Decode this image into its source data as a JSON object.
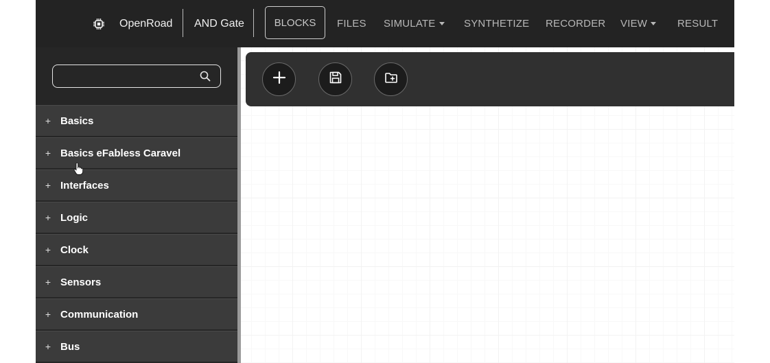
{
  "app": {
    "name": "OpenRoad",
    "project": "AND Gate",
    "logo_icon": "chip-icon"
  },
  "nav": {
    "items": [
      {
        "label": "BLOCKS",
        "active": true,
        "dropdown": false
      },
      {
        "label": "FILES",
        "active": false,
        "dropdown": false
      },
      {
        "label": "SIMULATE",
        "active": false,
        "dropdown": true
      },
      {
        "label": "SYNTHETIZE",
        "active": false,
        "dropdown": false
      },
      {
        "label": "RECORDER",
        "active": false,
        "dropdown": false
      },
      {
        "label": "VIEW",
        "active": false,
        "dropdown": true
      },
      {
        "label": "RESULT",
        "active": false,
        "dropdown": false
      }
    ]
  },
  "sidebar": {
    "search": {
      "value": "",
      "placeholder": "",
      "icon": "search-icon"
    },
    "categories": [
      {
        "expander": "+",
        "label": "Basics"
      },
      {
        "expander": "+",
        "label": "Basics eFabless Caravel"
      },
      {
        "expander": "+",
        "label": "Interfaces"
      },
      {
        "expander": "+",
        "label": "Logic"
      },
      {
        "expander": "+",
        "label": "Clock"
      },
      {
        "expander": "+",
        "label": "Sensors"
      },
      {
        "expander": "+",
        "label": "Communication"
      },
      {
        "expander": "+",
        "label": "Bus"
      }
    ]
  },
  "toolbar": {
    "buttons": [
      {
        "name": "add-block-button",
        "icon": "plus-icon"
      },
      {
        "name": "save-button",
        "icon": "floppy-disk-icon"
      },
      {
        "name": "open-folder-button",
        "icon": "folder-add-icon"
      }
    ]
  },
  "colors": {
    "topbar_bg": "#232323",
    "sidebar_bg": "#262626",
    "category_bg": "#3b3b3b",
    "toolbar_bg": "#303030",
    "button_bg": "#1c1c1c"
  }
}
